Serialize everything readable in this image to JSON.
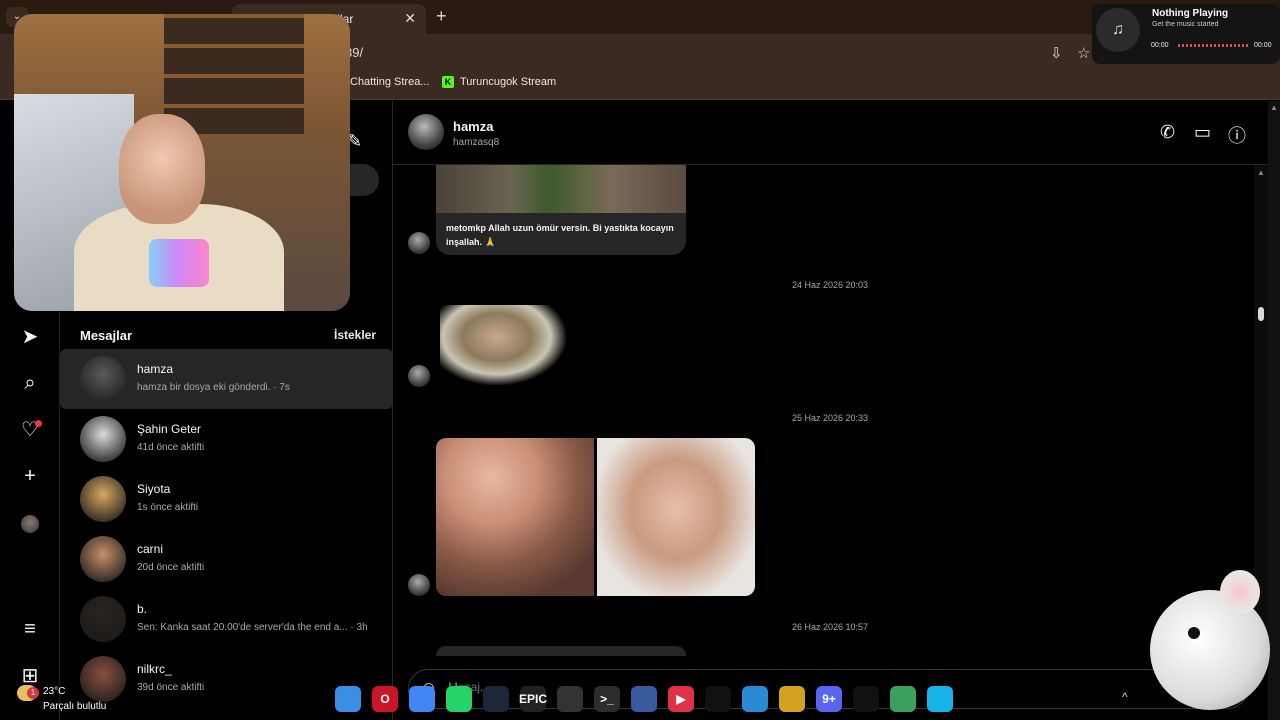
{
  "browser": {
    "tab_title": "esajlar",
    "new_tab_label": "+",
    "url": "39/",
    "bookmarks": [
      "Chatting Strea...",
      "Turuncugok Stream"
    ]
  },
  "music_widget": {
    "title": "Nothing Playing",
    "subtitle": "Get the music started",
    "time_start": "00:00",
    "time_end": "00:00"
  },
  "rail": {
    "icons": [
      "send-icon",
      "search-icon",
      "heart-icon",
      "plus-icon",
      "profile-avatar",
      "menu-icon",
      "apps-icon"
    ]
  },
  "inbox": {
    "title": "Mesajlar",
    "requests_label": "İstekler",
    "conversations": [
      {
        "name": "hamza",
        "sub": "hamza bir dosya eki gönderdi. · 7s",
        "avatar_color": "#5a5a5a"
      },
      {
        "name": "Şahin Geter",
        "sub": "41d önce aktifti",
        "avatar_color": "#dcdcdc"
      },
      {
        "name": "Siyota",
        "sub": "1s önce aktifti",
        "avatar_color": "#d8a860"
      },
      {
        "name": "carni",
        "sub": "20d önce aktifti",
        "avatar_color": "#c89068"
      },
      {
        "name": "b.",
        "sub": "Sen: Kanka saat 20.00'de server'da the end a... · 3h",
        "avatar_color": "#2a2420"
      },
      {
        "name": "nilkrc_",
        "sub": "39d önce aktifti",
        "avatar_color": "#8a5040"
      }
    ]
  },
  "chat": {
    "name": "hamza",
    "username": "hamzasq8",
    "message_text": "metomkp Allah uzun ömür versin. Bi yastıkta kocayın inşallah. 🙏",
    "timestamps": [
      "24 Haz 2026 20:03",
      "25 Haz 2026 20:33",
      "26 Haz 2026 10:57"
    ],
    "composer_placeholder": "Mesaj..."
  },
  "taskbar": {
    "weather_temp": "23°C",
    "weather_desc": "Parçalı bulutlu",
    "weather_badge": "1",
    "apps": [
      {
        "name": "windows-start",
        "label": "",
        "color": "#3a8ee6"
      },
      {
        "name": "opera",
        "label": "O",
        "color": "#cc1525"
      },
      {
        "name": "chrome",
        "label": "",
        "color": "#4285f4"
      },
      {
        "name": "whatsapp",
        "label": "",
        "color": "#25d366"
      },
      {
        "name": "steam",
        "label": "",
        "color": "#1b2838"
      },
      {
        "name": "epic-games",
        "label": "EPIC",
        "color": "#222"
      },
      {
        "name": "obs",
        "label": "",
        "color": "#333"
      },
      {
        "name": "terminal",
        "label": ">_",
        "color": "#2d2d2d"
      },
      {
        "name": "editor",
        "label": "",
        "color": "#3a5aa0"
      },
      {
        "name": "media-player",
        "label": "▶",
        "color": "#e0304a"
      },
      {
        "name": "capcut",
        "label": "",
        "color": "#111"
      },
      {
        "name": "file-app",
        "label": "",
        "color": "#2a8ad4"
      },
      {
        "name": "colorful-app",
        "label": "",
        "color": "#d4a020"
      },
      {
        "name": "discord",
        "label": "9+",
        "color": "#5865f2"
      },
      {
        "name": "capcut-2",
        "label": "",
        "color": "#111"
      },
      {
        "name": "globe-app",
        "label": "",
        "color": "#3aa060"
      },
      {
        "name": "kodi",
        "label": "",
        "color": "#17b2e7"
      }
    ]
  }
}
